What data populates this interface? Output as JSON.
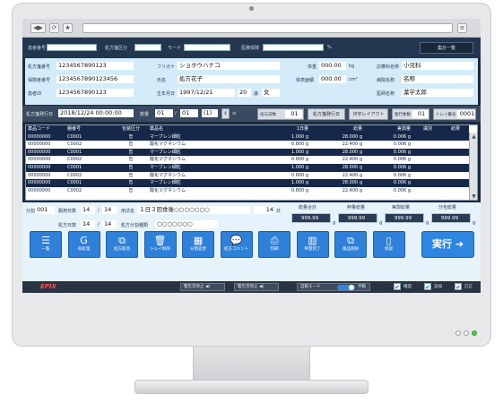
{
  "browser": {
    "nav_back": "◀",
    "nav_fwd": "▶",
    "reload": "⟳",
    "home": "★",
    "menu": "≡"
  },
  "search": {
    "labels": [
      "患者番号",
      "処方箋区分",
      "モード",
      "医療保険"
    ],
    "percent": "%",
    "action": "集計一覧"
  },
  "info": {
    "rx_no_label": "処方箋番号",
    "rx_no": "1234567890123",
    "insurance_label": "保険者番号",
    "insurance": "1234567890123456",
    "patient_label": "患者ID",
    "patient": "1234567890123",
    "furigana_label": "フリガナ",
    "furigana": "ショホウハナコ",
    "name_label": "氏名",
    "name": "処方花子",
    "dob_label": "生年月日",
    "dob": "1997/12/21",
    "age": "20",
    "age_unit": "歳",
    "sex": "女",
    "weight_label": "体重",
    "weight": "000.00",
    "weight_unit": "kg",
    "area_label": "体表面積",
    "area": "000.00",
    "area_unit": "cm²",
    "dept_label": "診療科名称",
    "dept": "小児科",
    "hospital_label": "病院名称",
    "hospital": "名称",
    "doctor_label": "医師名称",
    "doctor": "薬学太郎"
  },
  "issue": {
    "label": "処方箋発行日",
    "date": "2018/12/24 00:00:00",
    "dose_label": "数量",
    "dose_a": "01",
    "dose_b": "01",
    "dose_c": "(1)",
    "days_label": "投与日数",
    "days": "01",
    "btn_issue_date": "処方箋発行日",
    "btn_layout": "印字レイアウト",
    "issue_count_label": "発行枚数",
    "issue_count": "01",
    "tray_label": "トレイ番号",
    "tray": "0001"
  },
  "table": {
    "headers": [
      "薬品コード",
      "棚番号",
      "包装区分",
      "薬品名",
      "1日量",
      "総量",
      "実測量",
      "識別",
      "結果"
    ],
    "rows": [
      [
        "00000000",
        "C0001",
        "缶",
        "マーブレン細粒",
        "1.000 g",
        "28.000 g",
        "0.006 g",
        "",
        ""
      ],
      [
        "00000000",
        "C0002",
        "缶",
        "酸化マグネシウム",
        "0.800 g",
        "22.400 g",
        "0.006 g",
        "",
        ""
      ],
      [
        "00000000",
        "C0001",
        "缶",
        "マーブレン細粒",
        "1.000 g",
        "28.000 g",
        "0.006 g",
        "",
        ""
      ],
      [
        "00000000",
        "C0002",
        "缶",
        "酸化マグネシウム",
        "0.800 g",
        "22.400 g",
        "0.006 g",
        "",
        ""
      ],
      [
        "00000000",
        "C0001",
        "缶",
        "マーブレン細粒",
        "1.000 g",
        "28.000 g",
        "0.006 g",
        "",
        ""
      ],
      [
        "00000000",
        "C0002",
        "缶",
        "酸化マグネシウム",
        "0.800 g",
        "22.400 g",
        "0.006 g",
        "",
        ""
      ],
      [
        "00000000",
        "C0001",
        "缶",
        "マーブレン細粒",
        "1.000 g",
        "28.000 g",
        "0.006 g",
        "",
        ""
      ],
      [
        "00000000",
        "C0002",
        "缶",
        "酸化マグネシウム",
        "0.800 g",
        "22.400 g",
        "0.006 g",
        "",
        ""
      ]
    ]
  },
  "totals": {
    "cls_label": "分割",
    "cls": "001",
    "usage_days_label": "服用日数",
    "usage_days": "14",
    "usage_days2": "14",
    "usage_label": "用法名",
    "usage": "１日３回食後○○○○○○○",
    "usage_count": "14",
    "usage_count_unit": "日",
    "rx_days_label": "処方日数",
    "rx_days": "14",
    "rx_days2": "14",
    "split_label": "処方分割種類",
    "split": "○○○○○○○",
    "sum_label": "総量合計",
    "sum": "999.99",
    "sum_unit": "g",
    "measured_label": "秤量総量",
    "measured": "999.99",
    "measured_unit": "g",
    "actual_label": "実測総量",
    "actual": "999.99",
    "actual_unit": "g",
    "diff_label": "分包総量",
    "diff": "999.99",
    "diff_unit": "g"
  },
  "actions": [
    {
      "label": "一覧",
      "icon": "list-icon",
      "glyph": "☰"
    },
    {
      "label": "再処理",
      "icon": "g-icon",
      "glyph": "G"
    },
    {
      "label": "処方取消",
      "icon": "cancel-icon",
      "glyph": "⧉"
    },
    {
      "label": "トレイ削除",
      "icon": "trash-icon",
      "glyph": "🗑"
    },
    {
      "label": "分割変更",
      "icon": "split-icon",
      "glyph": "▦"
    },
    {
      "label": "処方コメント",
      "icon": "comment-icon",
      "glyph": "💬"
    },
    {
      "label": "印刷",
      "icon": "print-icon",
      "glyph": "⎙"
    },
    {
      "label": "秤量完了",
      "icon": "check-icon",
      "glyph": "▥"
    },
    {
      "label": "薬品削除",
      "icon": "delete-icon",
      "glyph": "⧉"
    },
    {
      "label": "保留",
      "icon": "hold-icon",
      "glyph": "▯"
    }
  ],
  "execute": {
    "label": "実行",
    "arrow": "➔"
  },
  "footer": {
    "logo": "EPIX",
    "mute1": "警告音停止",
    "mute2": "警告音停止",
    "auto_label": "自動モード",
    "auto_state": "手動",
    "chk1": "確認",
    "chk2": "追加",
    "chk3": "訂正",
    "check_mark": "✔"
  },
  "colors": {
    "accent": "#2f80d8",
    "dark": "#16284a",
    "panel": "#d4ecfa"
  }
}
